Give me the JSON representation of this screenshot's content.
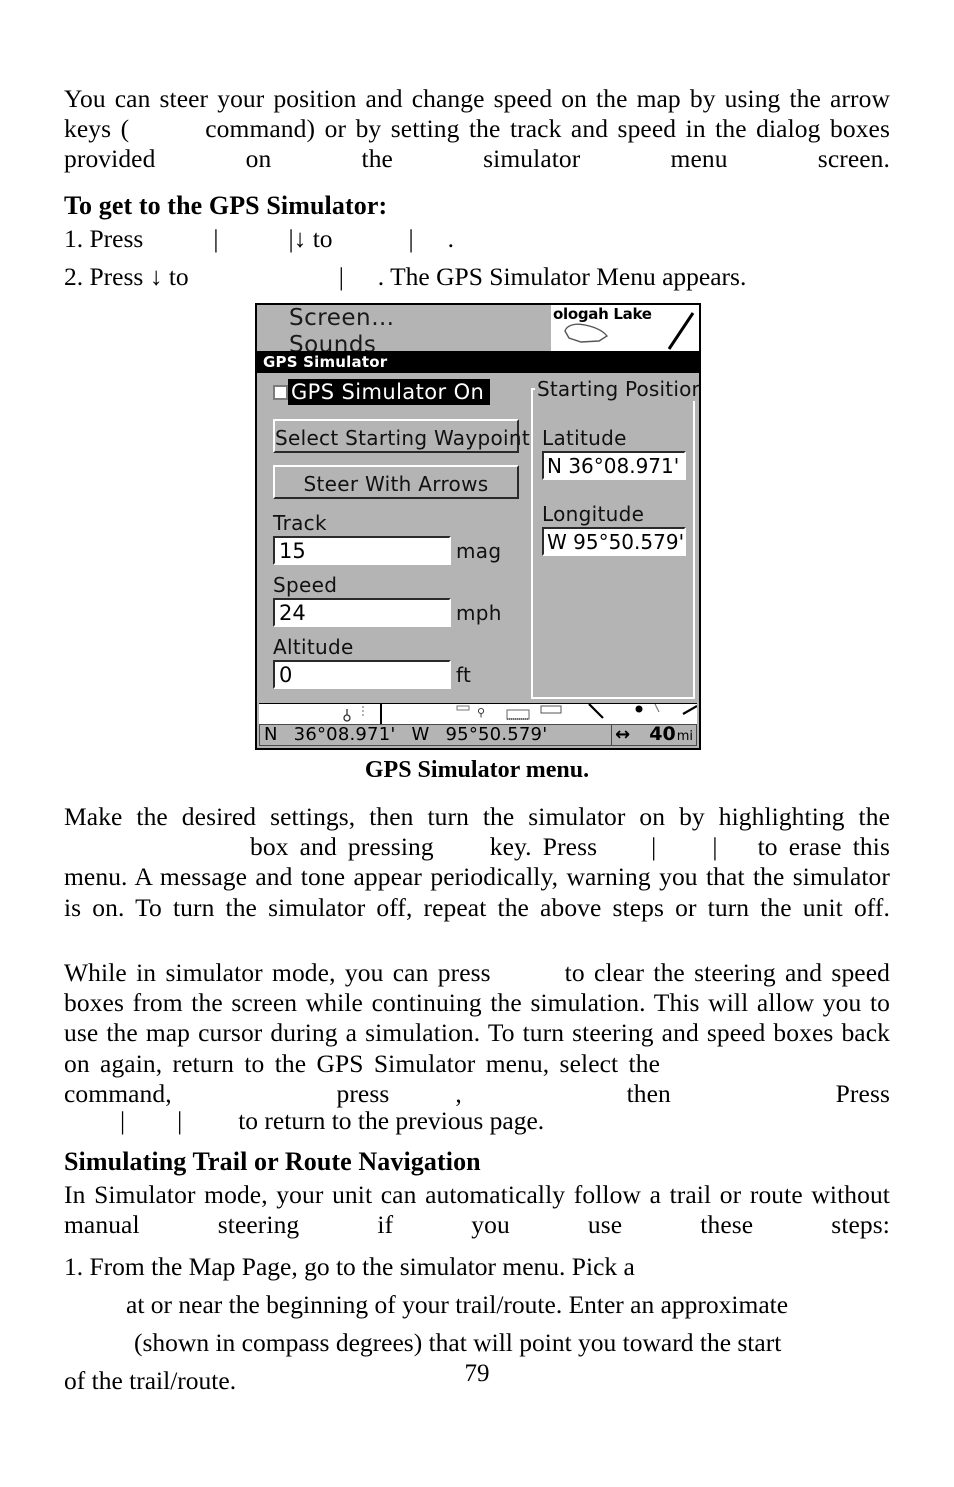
{
  "page_number": "79",
  "paragraphs": {
    "intro": {
      "run1": "You can steer your position and change speed on the map by using the arrow keys (",
      "run2": "command) or by setting the track and speed in the dialog boxes provided on the simulator menu screen."
    },
    "after_figure": {
      "run1": "Make the desired settings, then turn the simulator on by highlighting the",
      "run2": "box and pressing",
      "run3": "key. Press",
      "run4": "to erase this menu. A message and tone appear periodically, warning you that the simulator is on. To turn the simulator off, repeat the above steps or turn the unit off."
    },
    "simulator_mode": {
      "run1": "While in simulator mode, you can press",
      "run2": "to clear the steering and speed boxes from the screen while continuing the simulation. This will allow you to use the map cursor during a simulation. To turn steering and speed boxes back on again, return to the GPS Simulator menu, select the",
      "run3": "command, press",
      "run4": ", then Press",
      "run5": "to return to the previous page."
    },
    "trail_intro": "In Simulator mode, your unit can automatically follow a trail or route without manual steering if you use these steps:"
  },
  "headings": {
    "to_get_to": "To get to the GPS Simulator:",
    "simulating_trail": "Simulating Trail or Route Navigation"
  },
  "steps": {
    "step1": {
      "num": "1. Press",
      "sep1": "|",
      "sep2": "|",
      "arrow": "↓",
      "to": "to",
      "sep3": "|",
      "period": "."
    },
    "step2": {
      "num": "2. Press",
      "arrow": "↓",
      "to": "to",
      "sep": "|",
      "tail": ". The GPS Simulator Menu appears."
    },
    "trail_step1": {
      "line1": "1. From the Map Page, go to the simulator menu. Pick a",
      "line2": "at or near the beginning of your trail/route. Enter an approximate",
      "line3": "(shown in compass degrees) that will point you toward the start",
      "line4": "of the trail/route."
    }
  },
  "figure": {
    "caption": "GPS Simulator menu.",
    "background_menu": {
      "item1": "Screen…",
      "item2": "Sounds"
    },
    "minimap": {
      "label": "ologah Lake"
    },
    "titlebar": "GPS Simulator",
    "checkbox_row": {
      "label": "GPS Simulator On",
      "checked": false
    },
    "buttons": {
      "select_waypoint": "Select Starting Waypoint",
      "steer_with_arrows": "Steer With Arrows"
    },
    "fields": [
      {
        "label": "Track",
        "value": "15",
        "unit": "mag"
      },
      {
        "label": "Speed",
        "value": "24",
        "unit": "mph"
      },
      {
        "label": "Altitude",
        "value": "0",
        "unit": "ft"
      }
    ],
    "starting_position": {
      "title": "Starting Position",
      "latitude_label": "Latitude",
      "latitude_value": "N    36°08.971'",
      "longitude_label": "Longitude",
      "longitude_value": "W    95°50.579'"
    },
    "statusbar": {
      "lat_hemisphere": "N",
      "lat_value": "36°08.971'",
      "lon_hemisphere": "W",
      "lon_value": "95°50.579'",
      "zoom_arrow": "↔",
      "zoom_value": "40",
      "zoom_unit": "mi"
    }
  },
  "colors": {
    "device_bg": "#b4b4b4",
    "device_border": "#000000",
    "titlebar_bg": "#000000",
    "titlebar_fg": "#ffffff",
    "field_bg": "#ffffff",
    "page_bg": "#ffffff",
    "text": "#000000"
  }
}
